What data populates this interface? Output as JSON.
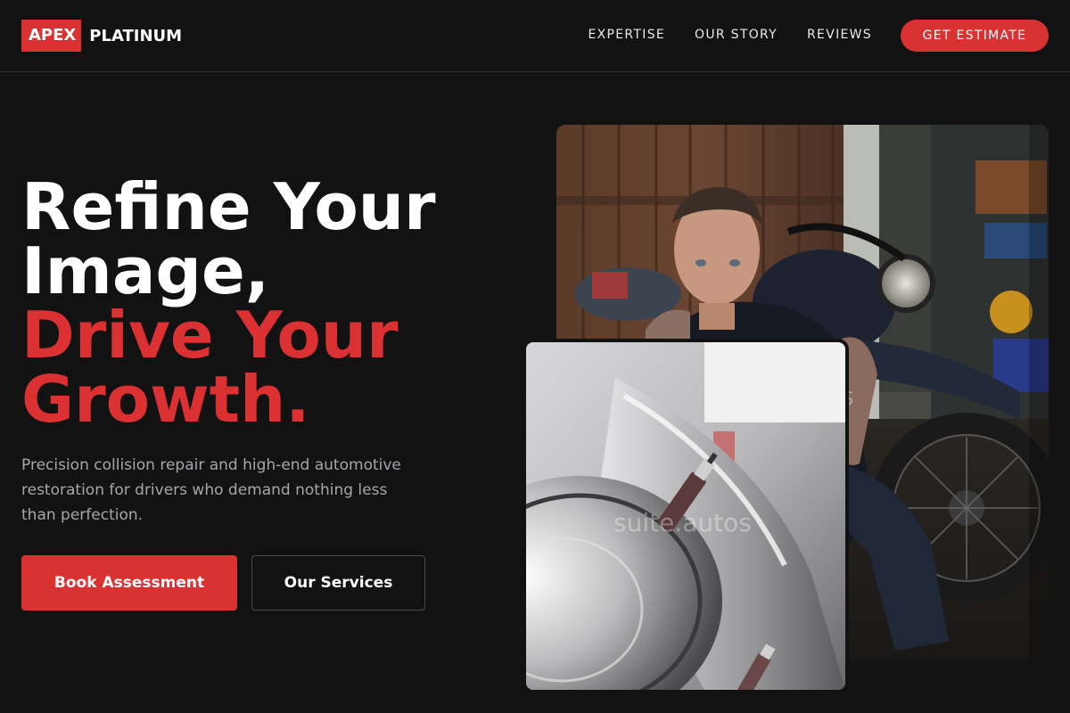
{
  "brand": {
    "badge": "APEX",
    "name": "PLATINUM",
    "accent_color": "#dc3132"
  },
  "nav": {
    "links": [
      "EXPERTISE",
      "OUR STORY",
      "REVIEWS"
    ],
    "cta": "GET ESTIMATE"
  },
  "hero": {
    "headline_white": [
      "Refine Your",
      "Image,"
    ],
    "headline_red": [
      "Drive Your",
      "Growth."
    ],
    "subtext": "Precision collision repair and high-end automotive restoration for drivers who demand nothing less than perfection.",
    "primary_button": "Book Assessment",
    "secondary_button": "Our Services"
  },
  "images": {
    "back_photo": "mechanic-with-motorcycle-photo",
    "front_photo": "car-headlight-polishing-photo",
    "watermark": "suite.autos",
    "watermark_back": "os"
  }
}
